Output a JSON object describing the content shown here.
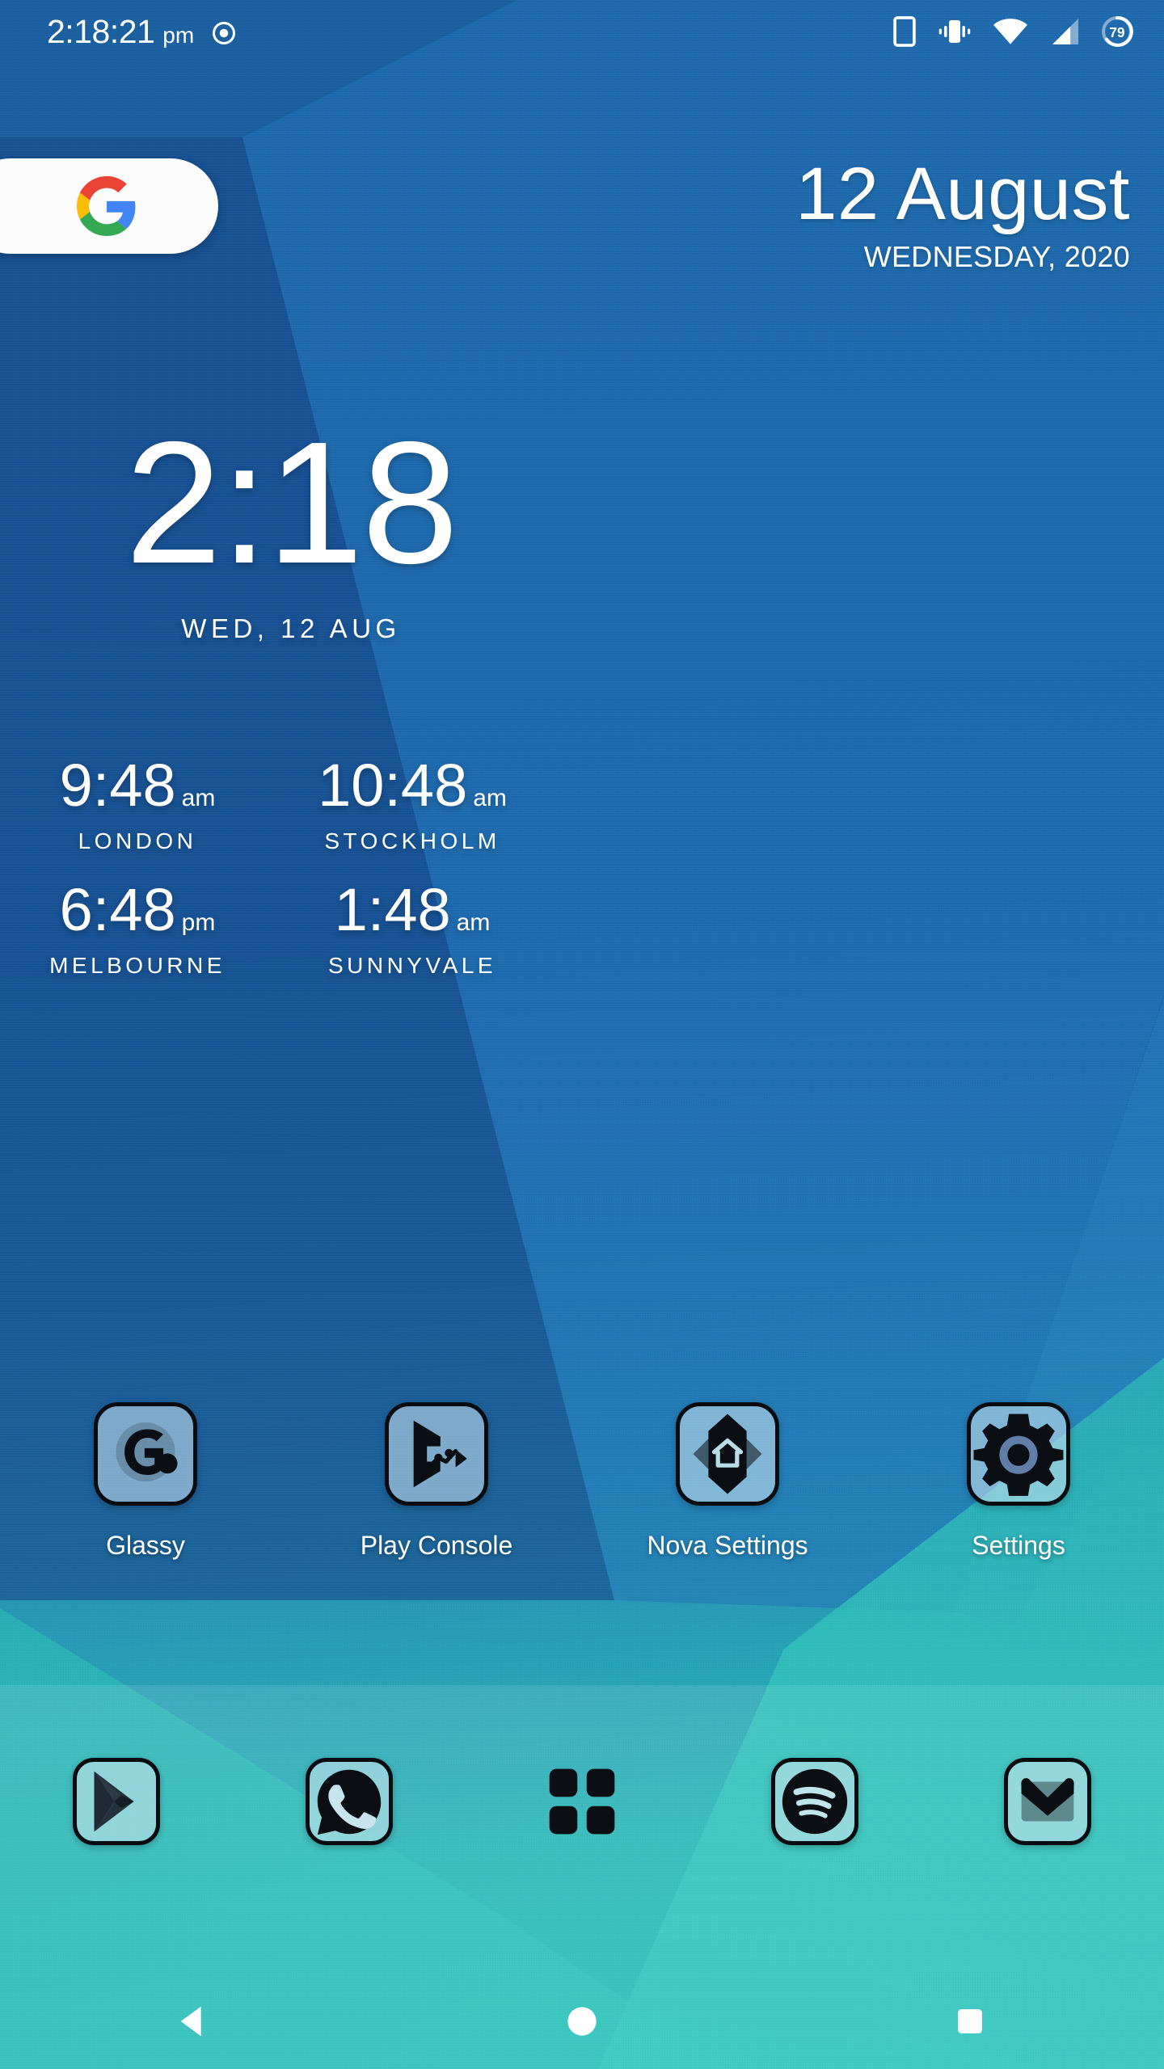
{
  "status_bar": {
    "clock": "2:18:21",
    "meridiem": "pm",
    "record_icon": "record-dot-icon",
    "icons": [
      {
        "name": "phone-outline-icon"
      },
      {
        "name": "vibrate-icon"
      },
      {
        "name": "wifi-icon"
      },
      {
        "name": "cellular-signal-icon"
      },
      {
        "name": "battery-icon"
      }
    ],
    "battery_level": "79"
  },
  "search_widget": {
    "name": "google-search-pill",
    "logo": "google-g-icon",
    "colors": {
      "red": "#EA4335",
      "yellow": "#FBBC05",
      "green": "#34A853",
      "blue": "#4285F4"
    }
  },
  "date_widget": {
    "day_month": "12 August",
    "weekday_year": "WEDNESDAY, 2020"
  },
  "clock_widget": {
    "time": "2:18",
    "date": "WED, 12 AUG"
  },
  "world_clocks": [
    {
      "time": "9:48",
      "meridiem": "am",
      "city": "LONDON"
    },
    {
      "time": "10:48",
      "meridiem": "am",
      "city": "STOCKHOLM"
    },
    {
      "time": "6:48",
      "meridiem": "pm",
      "city": "MELBOURNE"
    },
    {
      "time": "1:48",
      "meridiem": "am",
      "city": "SUNNYVALE"
    }
  ],
  "apps": [
    {
      "label": "Glassy",
      "icon": "glassy-icon"
    },
    {
      "label": "Play Console",
      "icon": "play-console-icon"
    },
    {
      "label": "Nova Settings",
      "icon": "nova-settings-icon"
    },
    {
      "label": "Settings",
      "icon": "settings-gear-icon"
    }
  ],
  "dock": [
    {
      "name": "play-store-icon"
    },
    {
      "name": "whatsapp-icon"
    },
    {
      "name": "app-drawer-icon"
    },
    {
      "name": "spotify-icon"
    },
    {
      "name": "gmail-icon"
    }
  ],
  "nav_bar": [
    {
      "name": "back-button"
    },
    {
      "name": "home-button"
    },
    {
      "name": "recents-button"
    }
  ],
  "theme": {
    "wallpaper_blue": "#1a60a2",
    "wallpaper_teal": "#31c4bc",
    "icon_outline": "#080c10",
    "text_on_wallpaper": "#ffffff"
  }
}
